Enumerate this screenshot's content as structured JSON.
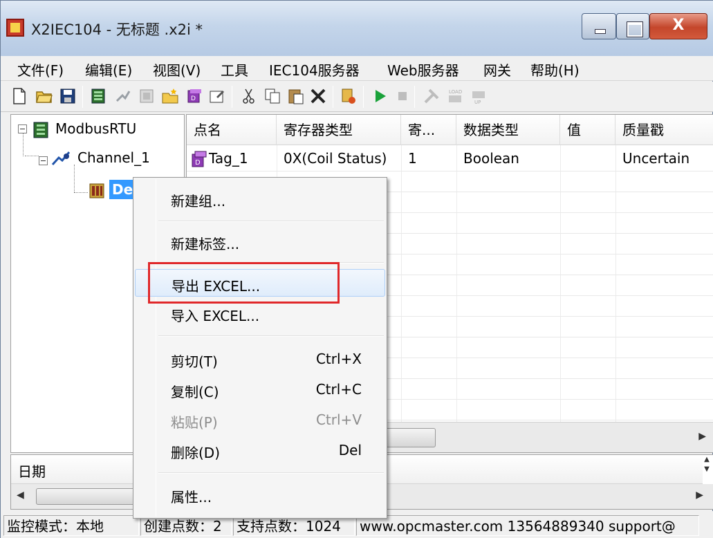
{
  "window": {
    "title": "X2IEC104 - 无标题 .x2i *",
    "close_label": "X"
  },
  "menubar": {
    "items": [
      "文件(F)",
      "编辑(E)",
      "视图(V)",
      "工具",
      "IEC104服务器",
      "Web服务器",
      "网关",
      "帮助(H)"
    ]
  },
  "toolbar": {
    "icons": [
      "new-file-icon",
      "open-folder-icon",
      "save-icon",
      "new-server-icon",
      "new-channel-icon",
      "new-device-icon",
      "new-group-icon",
      "new-tag-icon",
      "properties-icon",
      "cut-icon",
      "copy-icon",
      "paste-icon",
      "delete-icon",
      "import-icon",
      "run-icon",
      "stop-icon",
      "tools-icon",
      "load-icon",
      "unload-icon"
    ]
  },
  "tree": {
    "root": "ModbusRTU",
    "channel": "Channel_1",
    "device": "De"
  },
  "list": {
    "columns": [
      "点名",
      "寄存器类型",
      "寄...",
      "数据类型",
      "值",
      "质量戳"
    ],
    "rows": [
      {
        "name": "Tag_1",
        "register": "0X(Coil Status)",
        "addr": "1",
        "type": "Boolean",
        "value": "",
        "quality": "Uncertain"
      }
    ]
  },
  "log": {
    "column": "日期"
  },
  "statusbar": {
    "mode": "监控模式：本地",
    "created": "创建点数：2",
    "supported": "支持点数：1024",
    "contact": "www.opcmaster.com 13564889340 support@"
  },
  "context_menu": {
    "new_group": "新建组...",
    "new_tag": "新建标签...",
    "export_excel": "导出 EXCEL...",
    "import_excel": "导入 EXCEL...",
    "cut": "剪切(T)",
    "cut_shortcut": "Ctrl+X",
    "copy": "复制(C)",
    "copy_shortcut": "Ctrl+C",
    "paste": "粘贴(P)",
    "paste_shortcut": "Ctrl+V",
    "delete": "删除(D)",
    "delete_shortcut": "Del",
    "properties": "属性..."
  },
  "colors": {
    "highlight_box": "#e0282a",
    "selection": "#3399ff",
    "titlebar": "#c4d5ea"
  }
}
